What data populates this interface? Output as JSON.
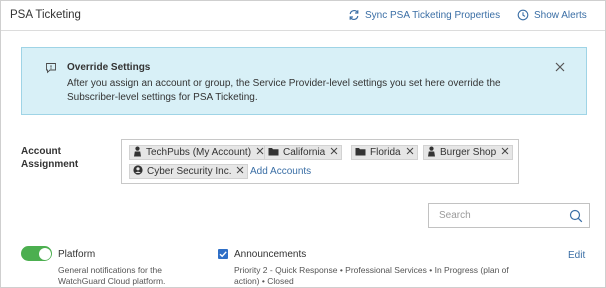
{
  "header": {
    "title": "PSA Ticketing",
    "sync_label": "Sync PSA Ticketing Properties",
    "alerts_label": "Show Alerts"
  },
  "banner": {
    "title": "Override Settings",
    "text": "After you assign an account or group, the Service Provider-level settings you set here override the Subscriber-level settings for PSA Ticketing."
  },
  "account_assignment": {
    "label": "Account Assignment",
    "tags": [
      {
        "label": "TechPubs (My Account)",
        "icon": "person-icon"
      },
      {
        "label": "California",
        "icon": "folder-icon"
      },
      {
        "label": "Florida",
        "icon": "folder-icon"
      },
      {
        "label": "Burger Shop",
        "icon": "person-icon"
      },
      {
        "label": "Cyber Security Inc.",
        "icon": "user-circle-icon"
      }
    ],
    "add_label": "Add Accounts"
  },
  "search": {
    "placeholder": "Search"
  },
  "notifications": {
    "platform": {
      "title": "Platform",
      "description": "General notifications for the WatchGuard Cloud platform.",
      "enabled": true
    },
    "announcements": {
      "title": "Announcements",
      "description": "Priority 2 - Quick Response • Professional Services • In Progress (plan of action) • Closed",
      "checked": true
    },
    "edit_label": "Edit"
  },
  "colors": {
    "link": "#3a6ea5",
    "banner_bg": "#d8f0f7",
    "toggle_on": "#4caf50",
    "checkbox": "#2f6fc7"
  }
}
